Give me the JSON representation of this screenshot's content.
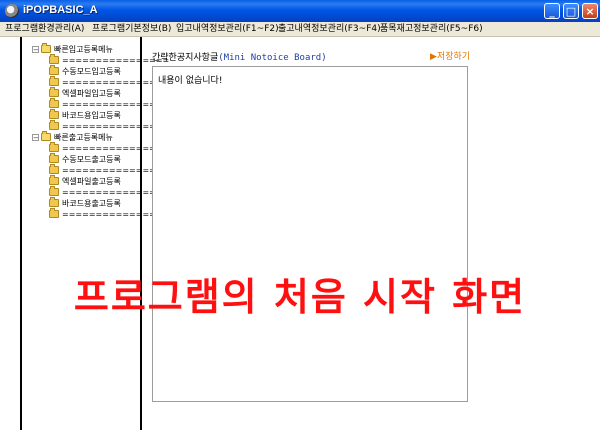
{
  "window": {
    "title": "iPOPBASIC_A",
    "buttons": {
      "minimize": "_",
      "maximize": "□",
      "close": "×"
    }
  },
  "menu": [
    "프로그램환경관리(A)",
    "프로그램기본정보(B)",
    "입고내역정보관리(F1~F2)",
    "출고내역정보관리(F3~F4)",
    "품목재고정보관리(F5~F6)"
  ],
  "tree": {
    "groups": [
      {
        "label": "빠른입고등록메뉴",
        "items": [
          "================",
          "수동모드입고등록",
          "================",
          "엑셀파일입고등록",
          "================",
          "바코드용입고등록",
          "================"
        ]
      },
      {
        "label": "빠른출고등록메뉴",
        "items": [
          "================",
          "수동모드출고등록",
          "================",
          "엑셀파일출고등록",
          "================",
          "바코드용출고등록",
          "================"
        ]
      }
    ]
  },
  "notice": {
    "title_ko": "간략한공지사항글",
    "title_en": "(Mini Notoice Board)",
    "save_label": "▶저장하기",
    "content": "내용이 없습니다!"
  },
  "overlay_text": "프로그램의  처음  시작  화면",
  "colors": {
    "title_bar": "#0055e5",
    "overlay": "#ff1010",
    "save_link": "#e07800",
    "notice_title_en": "#1f3fa0"
  }
}
